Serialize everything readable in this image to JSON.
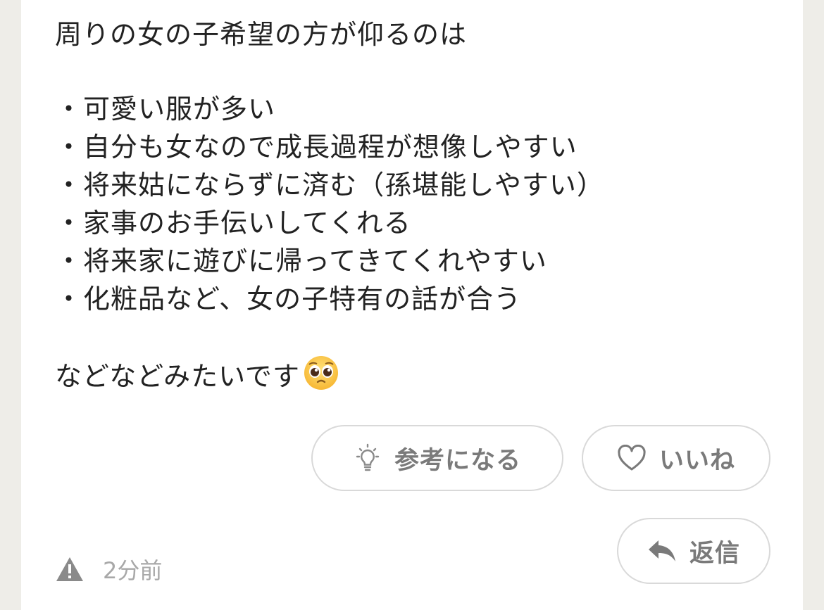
{
  "post": {
    "intro": "周りの女の子希望の方が仰るのは",
    "bullet": "・",
    "points": [
      "可愛い服が多い",
      "自分も女なので成長過程が想像しやすい",
      "将来姑にならずに済む（孫堪能しやすい）",
      "家事のお手伝いしてくれる",
      "将来家に遊びに帰ってきてくれやすい",
      "化粧品など、女の子特有の話が合う"
    ],
    "closing": "などなどみたいです",
    "closing_emoji": "pleading-face-emoji"
  },
  "actions": {
    "helpful_label": "参考になる",
    "helpful_icon": "lightbulb-icon",
    "like_label": "いいね",
    "like_icon": "heart-icon",
    "reply_label": "返信",
    "reply_icon": "reply-arrow-icon"
  },
  "meta": {
    "report_icon": "warning-icon",
    "timestamp": "2分前"
  },
  "colors": {
    "background": "#eeede8",
    "card": "#ffffff",
    "text": "#222222",
    "muted": "#a8a8a8",
    "button_border": "#d9d9d9",
    "button_text": "#7a7a7a"
  }
}
